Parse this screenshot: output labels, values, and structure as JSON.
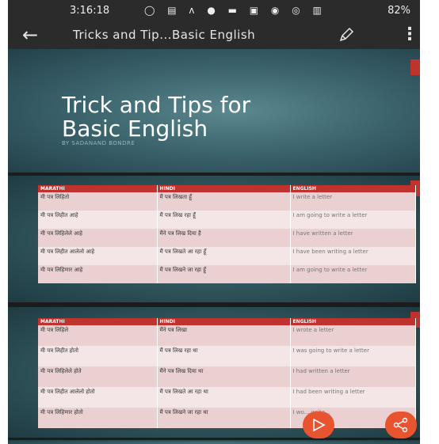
{
  "status_bar": {
    "time": "3:16:18",
    "battery": "82%"
  },
  "app_bar": {
    "title": "Tricks and Tip...Basic English"
  },
  "slide1": {
    "title_line1": "Trick and Tips for",
    "title_line2": "Basic English",
    "subtitle": "BY SADANAND BONDRE"
  },
  "table_headers": [
    "MARATHI",
    "HINDI",
    "ENGLISH"
  ],
  "slide2": {
    "rows": [
      [
        "मी पत्र लिहितो",
        "मैं पत्र लिखता हूँ",
        "I write a letter"
      ],
      [
        "मी पत्र लिहीत आहे",
        "मैं पत्र लिख रहा हूँ",
        "I am going to write a letter"
      ],
      [
        "मी पत्र लिहिलेले आहे",
        "मैंने पत्र लिख दिया है",
        "I have written a letter"
      ],
      [
        "मी पत्र लिहीत आलेलो आहे",
        "मैं पत्र लिखते आ रहा हूँ",
        "I have been writing a letter"
      ],
      [
        "मी पत्र लिहिणार आहे",
        "मैं पत्र लिखने जा रहा हूँ",
        "I am going to write a letter"
      ]
    ]
  },
  "slide3": {
    "rows": [
      [
        "मी पत्र लिहिले",
        "मैंने पत्र लिखा",
        "I wrote a letter"
      ],
      [
        "मी पत्र लिहीत होतो",
        "मैं पत्र लिख रहा था",
        "I was going to write a letter"
      ],
      [
        "मी पत्र लिहिलेले होते",
        "मैंने पत्र लिख दिया था",
        "I had written a letter"
      ],
      [
        "मी पत्र लिहीत आलेलो होतो",
        "मैं पत्र लिखते आ रहा था",
        "I had been writing a letter"
      ],
      [
        "मी पत्र लिहिणार होतो",
        "मैं पत्र लिखने जा रहा था",
        "I wo... write..."
      ]
    ]
  },
  "icons": {
    "back": "back-arrow-icon",
    "edit": "pencil-icon",
    "more": "more-vert-icon",
    "play": "play-icon",
    "share": "share-icon"
  },
  "colors": {
    "accent": "#c0322e",
    "fab": "#e8542f",
    "slide_bg": "#3d666f",
    "app_bar": "#2b2b2b"
  }
}
